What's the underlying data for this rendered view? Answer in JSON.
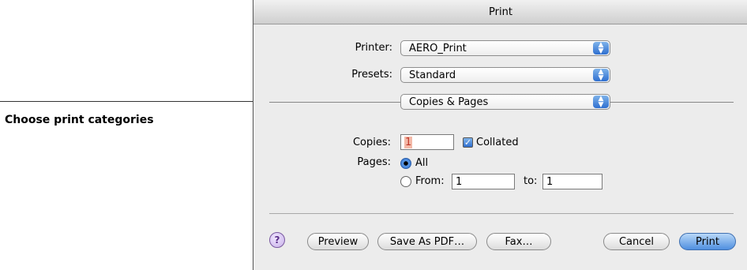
{
  "callout": {
    "text": "Choose print categories"
  },
  "window": {
    "title": "Print"
  },
  "printer": {
    "label": "Printer:",
    "value": "AERO_Print"
  },
  "presets": {
    "label": "Presets:",
    "value": "Standard"
  },
  "category": {
    "value": "Copies & Pages"
  },
  "copies": {
    "label": "Copies:",
    "value": "1",
    "collated_label": "Collated",
    "collated": true
  },
  "pages": {
    "label": "Pages:",
    "all_label": "All",
    "from_label": "From:",
    "from_value": "1",
    "to_label": "to:",
    "to_value": "1",
    "selected": "All"
  },
  "buttons": {
    "help": "?",
    "preview": "Preview",
    "save_pdf": "Save As PDF…",
    "fax": "Fax…",
    "cancel": "Cancel",
    "print": "Print"
  },
  "icons": {
    "help": "help-icon",
    "popup_arrows": "up-down-arrows-icon",
    "checkmark": "checkmark-icon",
    "radio": "radio-dot-icon"
  },
  "colors": {
    "accent": "#2f6fd0",
    "window_bg": "#ececec",
    "primary_button": "#4f8fe0"
  }
}
